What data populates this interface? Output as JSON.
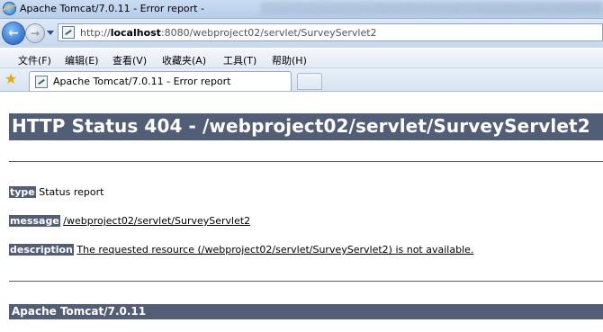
{
  "window": {
    "title": "Apache Tomcat/7.0.11 - Error report -"
  },
  "address_bar": {
    "url_prefix": "http://",
    "url_host": "localhost",
    "url_rest": ":8080/webproject02/servlet/SurveyServlet2"
  },
  "menu": {
    "items": [
      "文件(F)",
      "编辑(E)",
      "查看(V)",
      "收藏夹(A)",
      "工具(T)",
      "帮助(H)"
    ]
  },
  "tab": {
    "label": "Apache Tomcat/7.0.11 - Error report"
  },
  "page": {
    "heading": "HTTP Status 404 - /webproject02/servlet/SurveyServlet2",
    "type_key": "type",
    "type_value": "Status report",
    "message_key": "message",
    "message_value": "/webproject02/servlet/SurveyServlet2",
    "description_key": "description",
    "description_value": "The requested resource (/webproject02/servlet/SurveyServlet2) is not available.",
    "footer": "Apache Tomcat/7.0.11"
  },
  "colors": {
    "tomcat_bar": "#525d76"
  },
  "icons": {
    "browser": "ie-icon",
    "back": "back-arrow-icon",
    "forward": "forward-arrow-icon",
    "favorites": "favorites-star-icon",
    "page": "page-favicon"
  }
}
